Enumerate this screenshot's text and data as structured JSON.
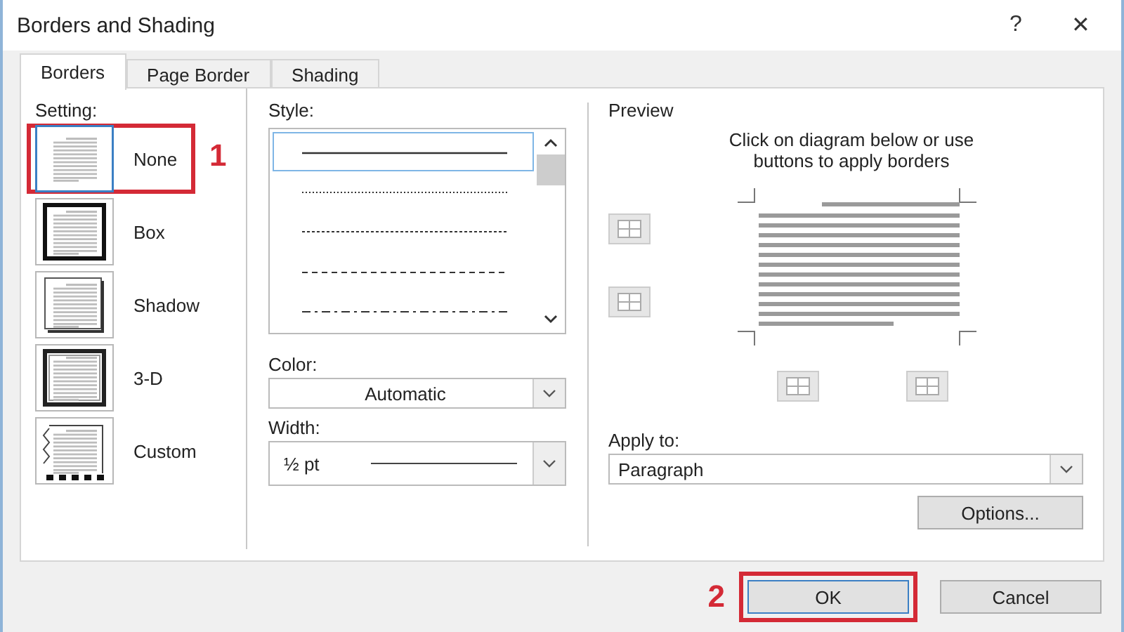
{
  "window": {
    "title": "Borders and Shading",
    "help": "?",
    "close": "✕"
  },
  "tabs": [
    {
      "label": "Borders",
      "selected": true
    },
    {
      "label": "Page Border",
      "selected": false
    },
    {
      "label": "Shading",
      "selected": false
    }
  ],
  "setting": {
    "label": "Setting:",
    "items": [
      {
        "label": "None",
        "kind": "none",
        "selected": true,
        "annotation": "1"
      },
      {
        "label": "Box",
        "kind": "box",
        "selected": false
      },
      {
        "label": "Shadow",
        "kind": "shadow",
        "selected": false
      },
      {
        "label": "3-D",
        "kind": "three-d",
        "selected": false
      },
      {
        "label": "Custom",
        "kind": "custom",
        "selected": false
      }
    ]
  },
  "style": {
    "label": "Style:",
    "lines": [
      {
        "kind": "solid",
        "selected": true
      },
      {
        "kind": "dotted",
        "selected": false
      },
      {
        "kind": "fine-dash",
        "selected": false
      },
      {
        "kind": "dashed",
        "selected": false
      },
      {
        "kind": "dash-dot",
        "selected": false
      }
    ]
  },
  "color": {
    "label": "Color:",
    "value": "Automatic"
  },
  "width": {
    "label": "Width:",
    "value": "½ pt"
  },
  "preview": {
    "title": "Preview",
    "hint": "Click on diagram below or use buttons to apply borders"
  },
  "apply_to": {
    "label": "Apply to:",
    "value": "Paragraph"
  },
  "options_button": "Options...",
  "buttons": [
    {
      "label": "OK",
      "annotation": "2"
    },
    {
      "label": "Cancel"
    }
  ]
}
